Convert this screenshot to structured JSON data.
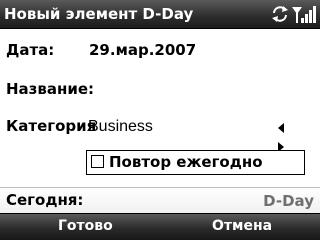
{
  "title_bar": {
    "title": "Новый элемент D-Day",
    "icons": [
      "sync-icon",
      "signal-icon"
    ]
  },
  "form": {
    "date_label": "Дата:",
    "date_value": "29.мар.2007",
    "name_label": "Название:",
    "category_label": "Категория",
    "category_value": "Business",
    "repeat_label": "Повтор ежегодно",
    "repeat_checked": false
  },
  "info": {
    "today_label": "Сегодня:",
    "dday_label": "D-Day"
  },
  "softkeys": {
    "left": "Готово",
    "right": "Отмена"
  }
}
